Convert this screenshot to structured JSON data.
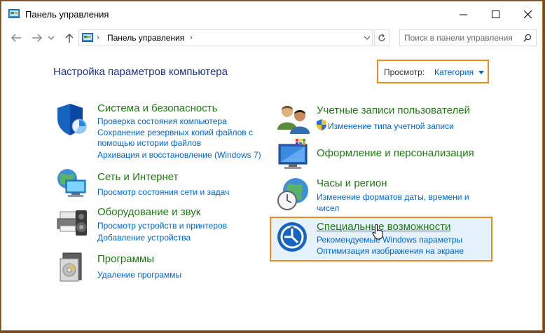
{
  "window": {
    "title": "Панель управления"
  },
  "address": {
    "path": "Панель управления",
    "separator": "›"
  },
  "search": {
    "placeholder": "Поиск в панели управления"
  },
  "header": {
    "title": "Настройка параметров компьютера",
    "view_label": "Просмотр:",
    "view_value": "Категория"
  },
  "categories": {
    "system": {
      "title": "Система и безопасность",
      "links": [
        "Проверка состояния компьютера",
        "Сохранение резервных копий файлов с",
        "помощью истории файлов",
        "Архивация и восстановление (Windows 7)"
      ]
    },
    "network": {
      "title": "Сеть и Интернет",
      "links": [
        "Просмотр состояния сети и задач"
      ]
    },
    "hardware": {
      "title": "Оборудование и звук",
      "links": [
        "Просмотр устройств и принтеров",
        "Добавление устройства"
      ]
    },
    "programs": {
      "title": "Программы",
      "links": [
        "Удаление программы"
      ]
    },
    "users": {
      "title": "Учетные записи пользователей",
      "links": [
        "Изменение типа учетной записи"
      ]
    },
    "appearance": {
      "title": "Оформление и персонализация",
      "links": []
    },
    "clock": {
      "title": "Часы и регион",
      "links": [
        "Изменение форматов даты, времени и",
        "чисел"
      ]
    },
    "access": {
      "title": "Специальные возможности",
      "links": [
        "Рекомендуемые Windows параметры",
        "Оптимизация изображения на экране"
      ]
    }
  },
  "colors": {
    "accent": "#0066cc",
    "category_title": "#1f7a12",
    "highlight_border": "#f08a1c",
    "page_title": "#1e3287"
  }
}
